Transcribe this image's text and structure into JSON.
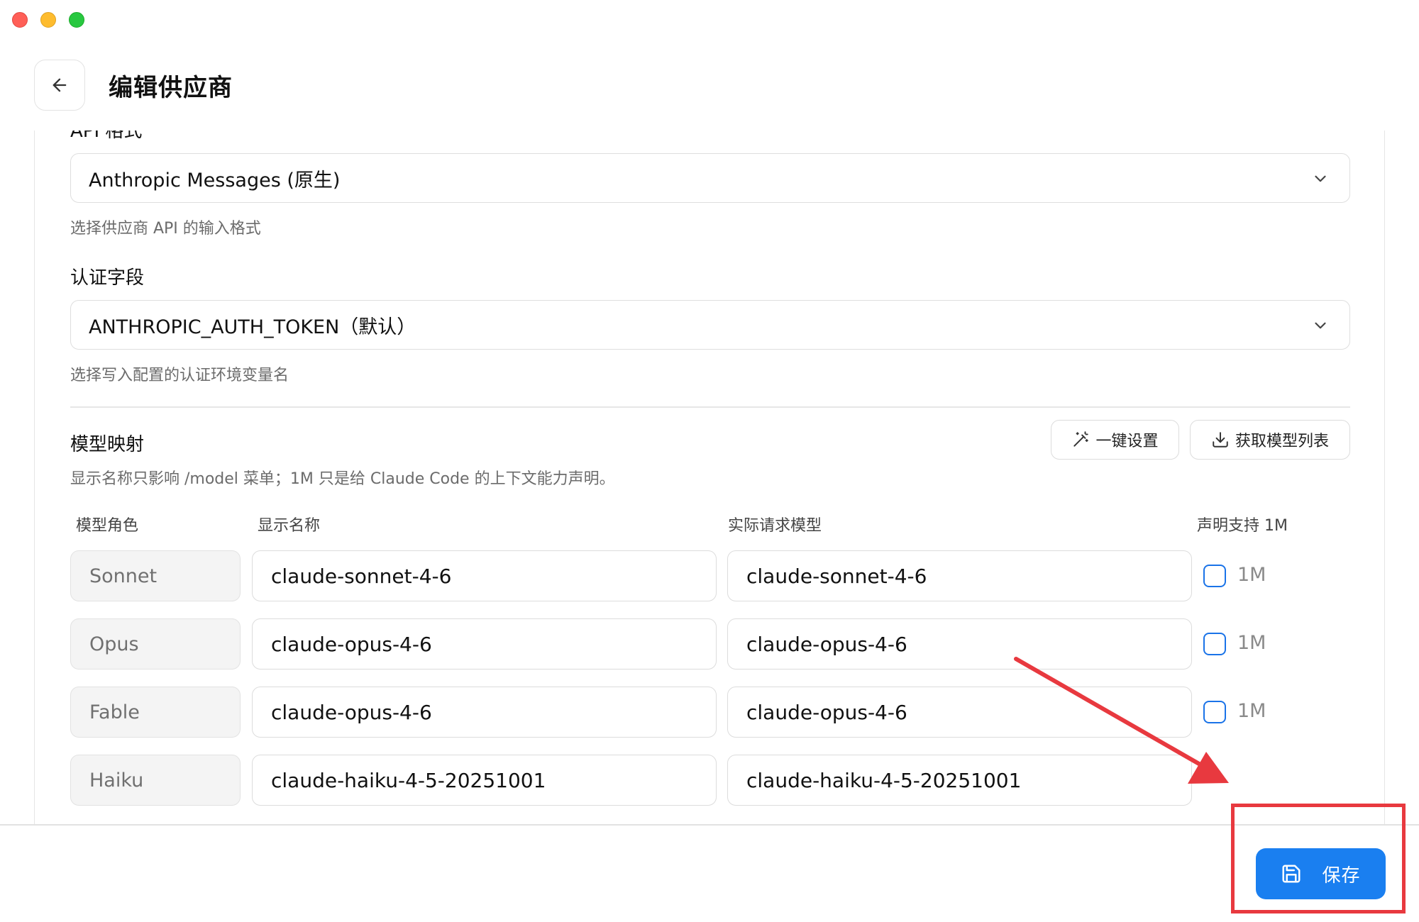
{
  "window": {
    "controls": [
      "close",
      "minimize",
      "zoom"
    ]
  },
  "header": {
    "back_icon": "arrow-left-icon",
    "title": "编辑供应商"
  },
  "api_format": {
    "label_cut": "API 格式",
    "value": "Anthropic Messages (原生)",
    "hint": "选择供应商 API 的输入格式"
  },
  "auth_field": {
    "label": "认证字段",
    "value": "ANTHROPIC_AUTH_TOKEN（默认）",
    "hint": "选择写入配置的认证环境变量名"
  },
  "model_mapping": {
    "label": "模型映射",
    "quick_setup_label": "一键设置",
    "fetch_models_label": "获取模型列表",
    "hint": "显示名称只影响 /model 菜单；1M 只是给 Claude Code 的上下文能力声明。",
    "columns": {
      "role": "模型角色",
      "display_name": "显示名称",
      "request_model": "实际请求模型",
      "support_1m": "声明支持 1M"
    },
    "rows": [
      {
        "role": "Sonnet",
        "display_name": "claude-sonnet-4-6",
        "request_model": "claude-sonnet-4-6",
        "checkbox_label": "1M",
        "checked": false
      },
      {
        "role": "Opus",
        "display_name": "claude-opus-4-6",
        "request_model": "claude-opus-4-6",
        "checkbox_label": "1M",
        "checked": false
      },
      {
        "role": "Fable",
        "display_name": "claude-opus-4-6",
        "request_model": "claude-opus-4-6",
        "checkbox_label": "1M",
        "checked": false
      },
      {
        "role": "Haiku",
        "display_name": "claude-haiku-4-5-20251001",
        "request_model": "claude-haiku-4-5-20251001"
      }
    ]
  },
  "footer": {
    "save_label": "保存",
    "save_icon": "floppy-disk-icon"
  },
  "colors": {
    "accent": "#1a7ff0",
    "checkbox": "#1a73e8",
    "annotation": "#e8393f"
  }
}
